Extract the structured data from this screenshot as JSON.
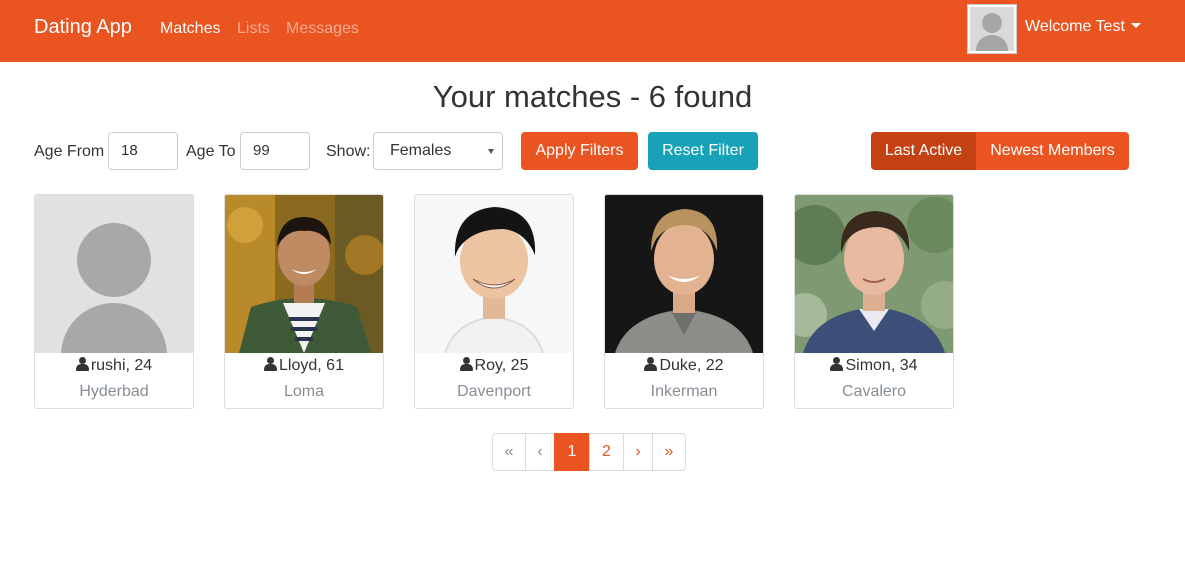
{
  "navbar": {
    "brand": "Dating App",
    "links": [
      "Matches",
      "Lists",
      "Messages"
    ],
    "welcome": "Welcome Test",
    "color": "#e95420"
  },
  "title": "Your matches - 6 found",
  "filters": {
    "age_from_label": "Age From",
    "age_from_value": "18",
    "age_to_label": "Age To",
    "age_to_value": "99",
    "show_label": "Show:",
    "show_value": "Females",
    "apply_label": "Apply Filters",
    "reset_label": "Reset Filter",
    "sort_active": "Last Active",
    "sort_newest": "Newest Members"
  },
  "members": [
    {
      "name": "rushi, 24",
      "city": "Hyderbad",
      "photo": "placeholder-avatar"
    },
    {
      "name": "Lloyd, 61",
      "city": "Loma",
      "photo": "man-green-jacket"
    },
    {
      "name": "Roy, 25",
      "city": "Davenport",
      "photo": "man-white-background"
    },
    {
      "name": "Duke, 22",
      "city": "Inkerman",
      "photo": "man-dark-background"
    },
    {
      "name": "Simon, 34",
      "city": "Cavalero",
      "photo": "man-outdoor-trees"
    }
  ],
  "pagination": {
    "first": "«",
    "prev": "‹",
    "pages": [
      "1",
      "2"
    ],
    "current": "1",
    "next": "›",
    "last": "»"
  },
  "colors": {
    "primary": "#e95420",
    "primary_dark": "#c34113",
    "teal": "#17a2b8",
    "muted": "#868e96"
  }
}
